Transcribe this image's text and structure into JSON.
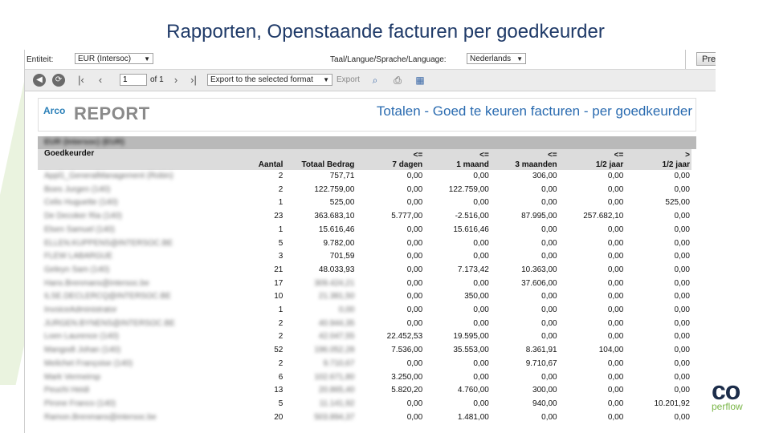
{
  "slide": {
    "title": "Rapporten, Openstaande facturen per goedkeurder",
    "brand_logo": "co",
    "brand_tagline": "perflow"
  },
  "params": {
    "entity_label": "Entiteit:",
    "entity_value": "EUR (Intersoc)",
    "language_label": "Taal/Langue/Sprache/Language:",
    "language_value": "Nederlands",
    "preview_button": "Pre"
  },
  "toolbar": {
    "icons": [
      "back-icon",
      "refresh-icon",
      "first-page-icon",
      "prev-page-icon",
      "next-page-icon",
      "last-page-icon",
      "zoom-icon",
      "print-icon",
      "export-data-icon"
    ],
    "page_value": "1",
    "of_text": "of 1",
    "export_format": "Export to the selected format",
    "export_label": "Export"
  },
  "report": {
    "logo_text": "Arco",
    "logo_sub": "",
    "report_word": "REPORT",
    "title": "Totalen - Goed te keuren facturen - per goedkeurder",
    "group_label": "EUR (Intersoc) (EUR)",
    "columns": [
      {
        "top": "Goedkeurder",
        "bottom": ""
      },
      {
        "top": "",
        "bottom": "Aantal"
      },
      {
        "top": "",
        "bottom": "Totaal Bedrag"
      },
      {
        "top": "<=",
        "bottom": "7 dagen"
      },
      {
        "top": "<=",
        "bottom": "1 maand"
      },
      {
        "top": "<=",
        "bottom": "3 maanden"
      },
      {
        "top": "<=",
        "bottom": "1/2 jaar"
      },
      {
        "top": ">",
        "bottom": "1/2 jaar"
      }
    ],
    "rows": [
      {
        "name": "Appl1_GeneralManagement (Robin)",
        "aantal": "2",
        "totaal": "757,71",
        "d7": "0,00",
        "m1": "0,00",
        "m3": "306,00",
        "hj": "0,00",
        "gt": "0,00",
        "blur_totaal": false
      },
      {
        "name": "Boes Jurgen (140)",
        "aantal": "2",
        "totaal": "122.759,00",
        "d7": "0,00",
        "m1": "122.759,00",
        "m3": "0,00",
        "hj": "0,00",
        "gt": "0,00",
        "blur_totaal": false
      },
      {
        "name": "Celis Huguette (140)",
        "aantal": "1",
        "totaal": "525,00",
        "d7": "0,00",
        "m1": "0,00",
        "m3": "0,00",
        "hj": "0,00",
        "gt": "525,00",
        "blur_totaal": false
      },
      {
        "name": "De Decoker Ria (140)",
        "aantal": "23",
        "totaal": "363.683,10",
        "d7": "5.777,00",
        "m1": "-2.516,00",
        "m3": "87.995,00",
        "hj": "257.682,10",
        "gt": "0,00",
        "blur_totaal": false
      },
      {
        "name": "Elsen Samuel (140)",
        "aantal": "1",
        "totaal": "15.616,46",
        "d7": "0,00",
        "m1": "15.616,46",
        "m3": "0,00",
        "hj": "0,00",
        "gt": "0,00",
        "blur_totaal": false
      },
      {
        "name": "ELLEN.KUPPENS@INTERSOC.BE",
        "aantal": "5",
        "totaal": "9.782,00",
        "d7": "0,00",
        "m1": "0,00",
        "m3": "0,00",
        "hj": "0,00",
        "gt": "0,00",
        "blur_totaal": false
      },
      {
        "name": "FLEW LABARGUE",
        "aantal": "3",
        "totaal": "701,59",
        "d7": "0,00",
        "m1": "0,00",
        "m3": "0,00",
        "hj": "0,00",
        "gt": "0,00",
        "blur_totaal": false
      },
      {
        "name": "Geleyn Sam (140)",
        "aantal": "21",
        "totaal": "48.033,93",
        "d7": "0,00",
        "m1": "7.173,42",
        "m3": "10.363,00",
        "hj": "0,00",
        "gt": "0,00",
        "blur_totaal": false
      },
      {
        "name": "Hans.Brenmans@intersoc.be",
        "aantal": "17",
        "totaal": "309.424,21",
        "d7": "0,00",
        "m1": "0,00",
        "m3": "37.606,00",
        "hj": "0,00",
        "gt": "0,00",
        "blur_totaal": true
      },
      {
        "name": "ILSE.DECLERCQ@INTERSOC.BE",
        "aantal": "10",
        "totaal": "21.381,50",
        "d7": "0,00",
        "m1": "350,00",
        "m3": "0,00",
        "hj": "0,00",
        "gt": "0,00",
        "blur_totaal": true
      },
      {
        "name": "InvoiceAdministrator",
        "aantal": "1",
        "totaal": "0,00",
        "d7": "0,00",
        "m1": "0,00",
        "m3": "0,00",
        "hj": "0,00",
        "gt": "0,00",
        "blur_totaal": true
      },
      {
        "name": "JURGEN.BYNENS@INTERSOC.BE",
        "aantal": "2",
        "totaal": "40.944,35",
        "d7": "0,00",
        "m1": "0,00",
        "m3": "0,00",
        "hj": "0,00",
        "gt": "0,00",
        "blur_totaal": true
      },
      {
        "name": "Loen Laurence (140)",
        "aantal": "2",
        "totaal": "42.047,55",
        "d7": "22.452,53",
        "m1": "19.595,00",
        "m3": "0,00",
        "hj": "0,00",
        "gt": "0,00",
        "blur_totaal": true
      },
      {
        "name": "Mangodt Johan (140)",
        "aantal": "52",
        "totaal": "196.052,28",
        "d7": "7.536,00",
        "m1": "35.553,00",
        "m3": "8.361,91",
        "hj": "104,00",
        "gt": "0,00",
        "blur_totaal": true
      },
      {
        "name": "Meilchet Françoise (140)",
        "aantal": "2",
        "totaal": "9.710,67",
        "d7": "0,00",
        "m1": "0,00",
        "m3": "9.710,67",
        "hj": "0,00",
        "gt": "0,00",
        "blur_totaal": true
      },
      {
        "name": "Mark Vermeirsp",
        "aantal": "6",
        "totaal": "102.671,80",
        "d7": "3.250,00",
        "m1": "0,00",
        "m3": "0,00",
        "hj": "0,00",
        "gt": "0,00",
        "blur_totaal": true
      },
      {
        "name": "Peuchi Heidi",
        "aantal": "13",
        "totaal": "20.865,40",
        "d7": "5.820,20",
        "m1": "4.760,00",
        "m3": "300,00",
        "hj": "0,00",
        "gt": "0,00",
        "blur_totaal": true
      },
      {
        "name": "Pirone Franco (140)",
        "aantal": "5",
        "totaal": "11.141,92",
        "d7": "0,00",
        "m1": "0,00",
        "m3": "940,00",
        "hj": "0,00",
        "gt": "10.201,92",
        "blur_totaal": true
      },
      {
        "name": "Ramon.Brenmans@intersoc.be",
        "aantal": "20",
        "totaal": "503.894,37",
        "d7": "0,00",
        "m1": "1.481,00",
        "m3": "0,00",
        "hj": "0,00",
        "gt": "0,00",
        "blur_totaal": true
      }
    ]
  }
}
